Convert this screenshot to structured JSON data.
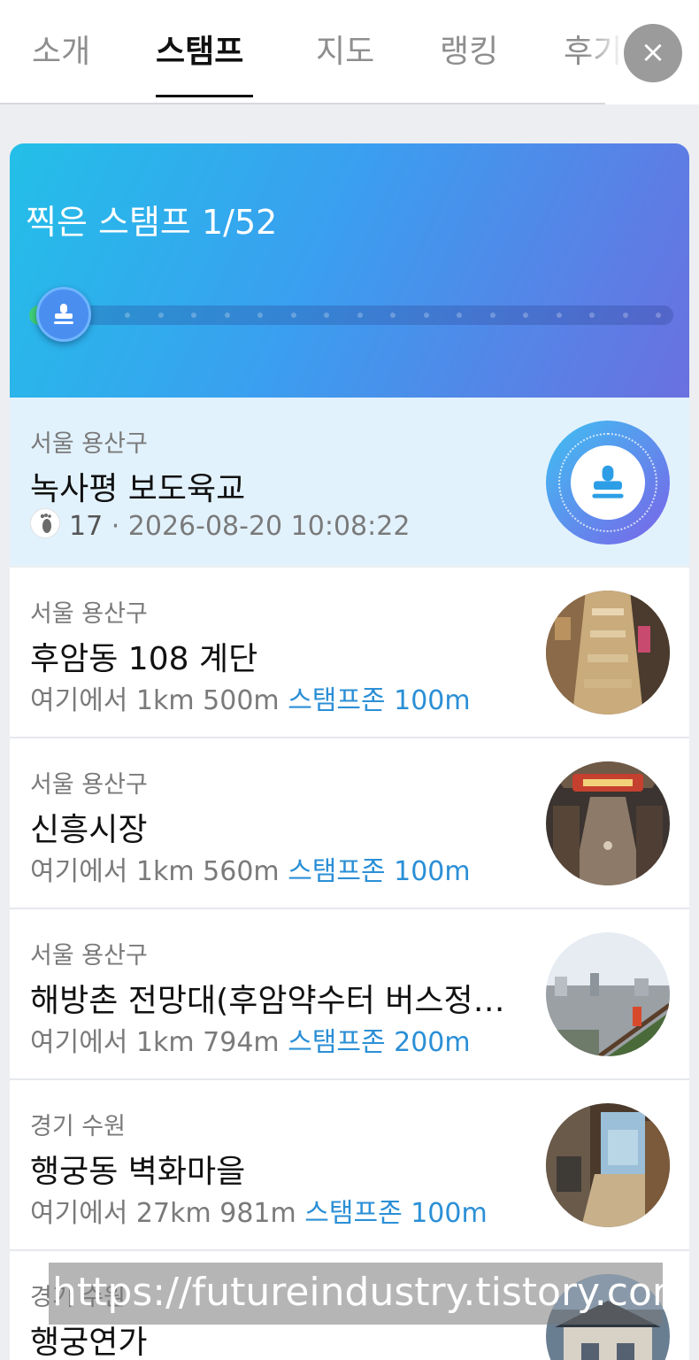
{
  "tabs": [
    {
      "label": "소개",
      "active": false
    },
    {
      "label": "스탬프",
      "active": true
    },
    {
      "label": "지도",
      "active": false
    },
    {
      "label": "랭킹",
      "active": false
    },
    {
      "label": "후기",
      "active": false
    }
  ],
  "close_label": "×",
  "stamp_header": {
    "title": "찍은 스탬프 1/52",
    "collected": 1,
    "total": 52
  },
  "stamps": [
    {
      "region": "서울 용산구",
      "name": "녹사평 보도육교",
      "steps": "17",
      "separator": " · ",
      "timestamp": "2026-08-20 10:08:22",
      "stamped": true
    },
    {
      "region": "서울 용산구",
      "name": "후암동 108 계단",
      "distance": "여기에서 1km 500m",
      "zone": "스탬프존 100m",
      "stamped": false
    },
    {
      "region": "서울 용산구",
      "name": "신흥시장",
      "distance": "여기에서 1km 560m",
      "zone": "스탬프존 100m",
      "stamped": false
    },
    {
      "region": "서울 용산구",
      "name": "해방촌 전망대(후암약수터 버스정…",
      "distance": "여기에서 1km 794m",
      "zone": "스탬프존 200m",
      "stamped": false
    },
    {
      "region": "경기 수원",
      "name": "행궁동 벽화마을",
      "distance": "여기에서 27km 981m",
      "zone": "스탬프존 100m",
      "stamped": false
    },
    {
      "region": "경기 수원",
      "name": "행궁연가",
      "stamped": false
    }
  ],
  "watermark": "https://futureindustry.tistory.com",
  "colors": {
    "accent_blue": "#2b8fd6",
    "stamped_bg": "#e2f2fd",
    "progress_green": "#3ed07a"
  }
}
